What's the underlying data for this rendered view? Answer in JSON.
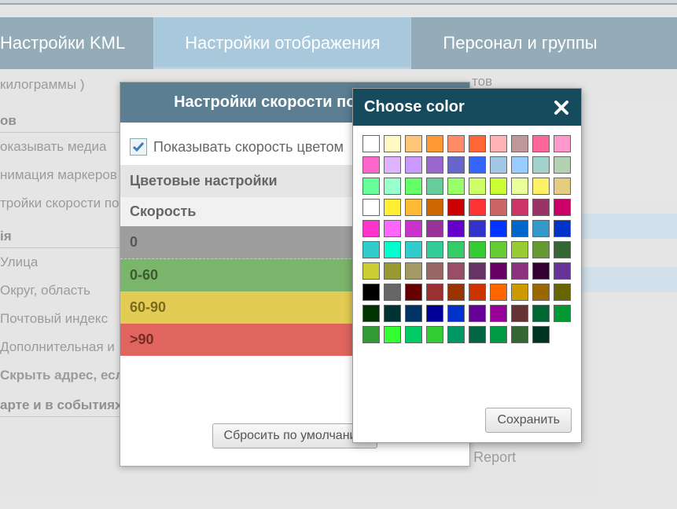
{
  "tabs": {
    "kml": "Настройки KML",
    "display": "Настройки отображения",
    "personnel": "Персонал и группы"
  },
  "bg": {
    "units": "килограммы )",
    "ov_suffix": "ов",
    "show_media": "оказывать медиа",
    "anim_markers": "нимация маркеров",
    "speed_settings": "тройки скорости по",
    "ia_legend": "ія",
    "street": "Улица",
    "region": "Округ, область",
    "postal": "Почтовый индекс",
    "additional": "Дополнительная и",
    "hide_addr": "Скрыть адрес, если есть геозона",
    "map_events": "арте и в событиях",
    "tov_suffix": "тов",
    "report_text": "Iman Group Refuels Report"
  },
  "modal1": {
    "title": "Настройки скорости по цветам",
    "show_speed_color": "Показывать скорость цветом",
    "color_settings": "Цветовые настройки",
    "speed": "Скорость",
    "rows": {
      "r0": "0",
      "r1": "0-60",
      "r2": "60-90",
      "r3": ">90"
    },
    "reset": "Сбросить по умолчанию"
  },
  "modal2": {
    "title": "Choose color",
    "save": "Сохранить",
    "colors": [
      "#ffffff",
      "#fff9c4",
      "#ffc67a",
      "#ff9933",
      "#ff8c66",
      "#ff6633",
      "#ffb3b3",
      "#bf9999",
      "#ff6699",
      "#ff99cc",
      "#ff66cc",
      "#e0b3ff",
      "#cc99ff",
      "#9966cc",
      "#6666cc",
      "#3366ff",
      "#a3c7e6",
      "#99ccff",
      "#a3d1cc",
      "#b3d1b3",
      "#66ff99",
      "#99ffcc",
      "#66ff66",
      "#66cc99",
      "#99ff66",
      "#ccff66",
      "#ccff33",
      "#eaff99",
      "#fff066",
      "#e6cc80",
      "#ffffff",
      "#ffee33",
      "#ffbb33",
      "#cc6600",
      "#cc0000",
      "#ff3333",
      "#cc6666",
      "#cc3366",
      "#993366",
      "#cc0066",
      "#ff33cc",
      "#ff66ff",
      "#cc33cc",
      "#993399",
      "#6600cc",
      "#3333cc",
      "#0033ff",
      "#0066cc",
      "#3399cc",
      "#0033cc",
      "#33cccc",
      "#00ffcc",
      "#33cccc",
      "#33cc99",
      "#33cc66",
      "#33cc33",
      "#66cc33",
      "#99cc33",
      "#669933",
      "#336633",
      "#cccc33",
      "#999933",
      "#a39966",
      "#996666",
      "#994d66",
      "#663366",
      "#660066",
      "#8c3380",
      "#330033",
      "#663399",
      "#000000",
      "#666666",
      "#660000",
      "#993333",
      "#993300",
      "#cc3300",
      "#ff6600",
      "#cc9900",
      "#996600",
      "#666600",
      "#003300",
      "#003333",
      "#003366",
      "#000099",
      "#0033cc",
      "#660099",
      "#990099",
      "#663333",
      "#006633",
      "#009933",
      "#339933",
      "#33ff33",
      "#00cc66",
      "#33cc33",
      "#009966",
      "#006644",
      "#009944",
      "#336633",
      "#003322"
    ]
  }
}
